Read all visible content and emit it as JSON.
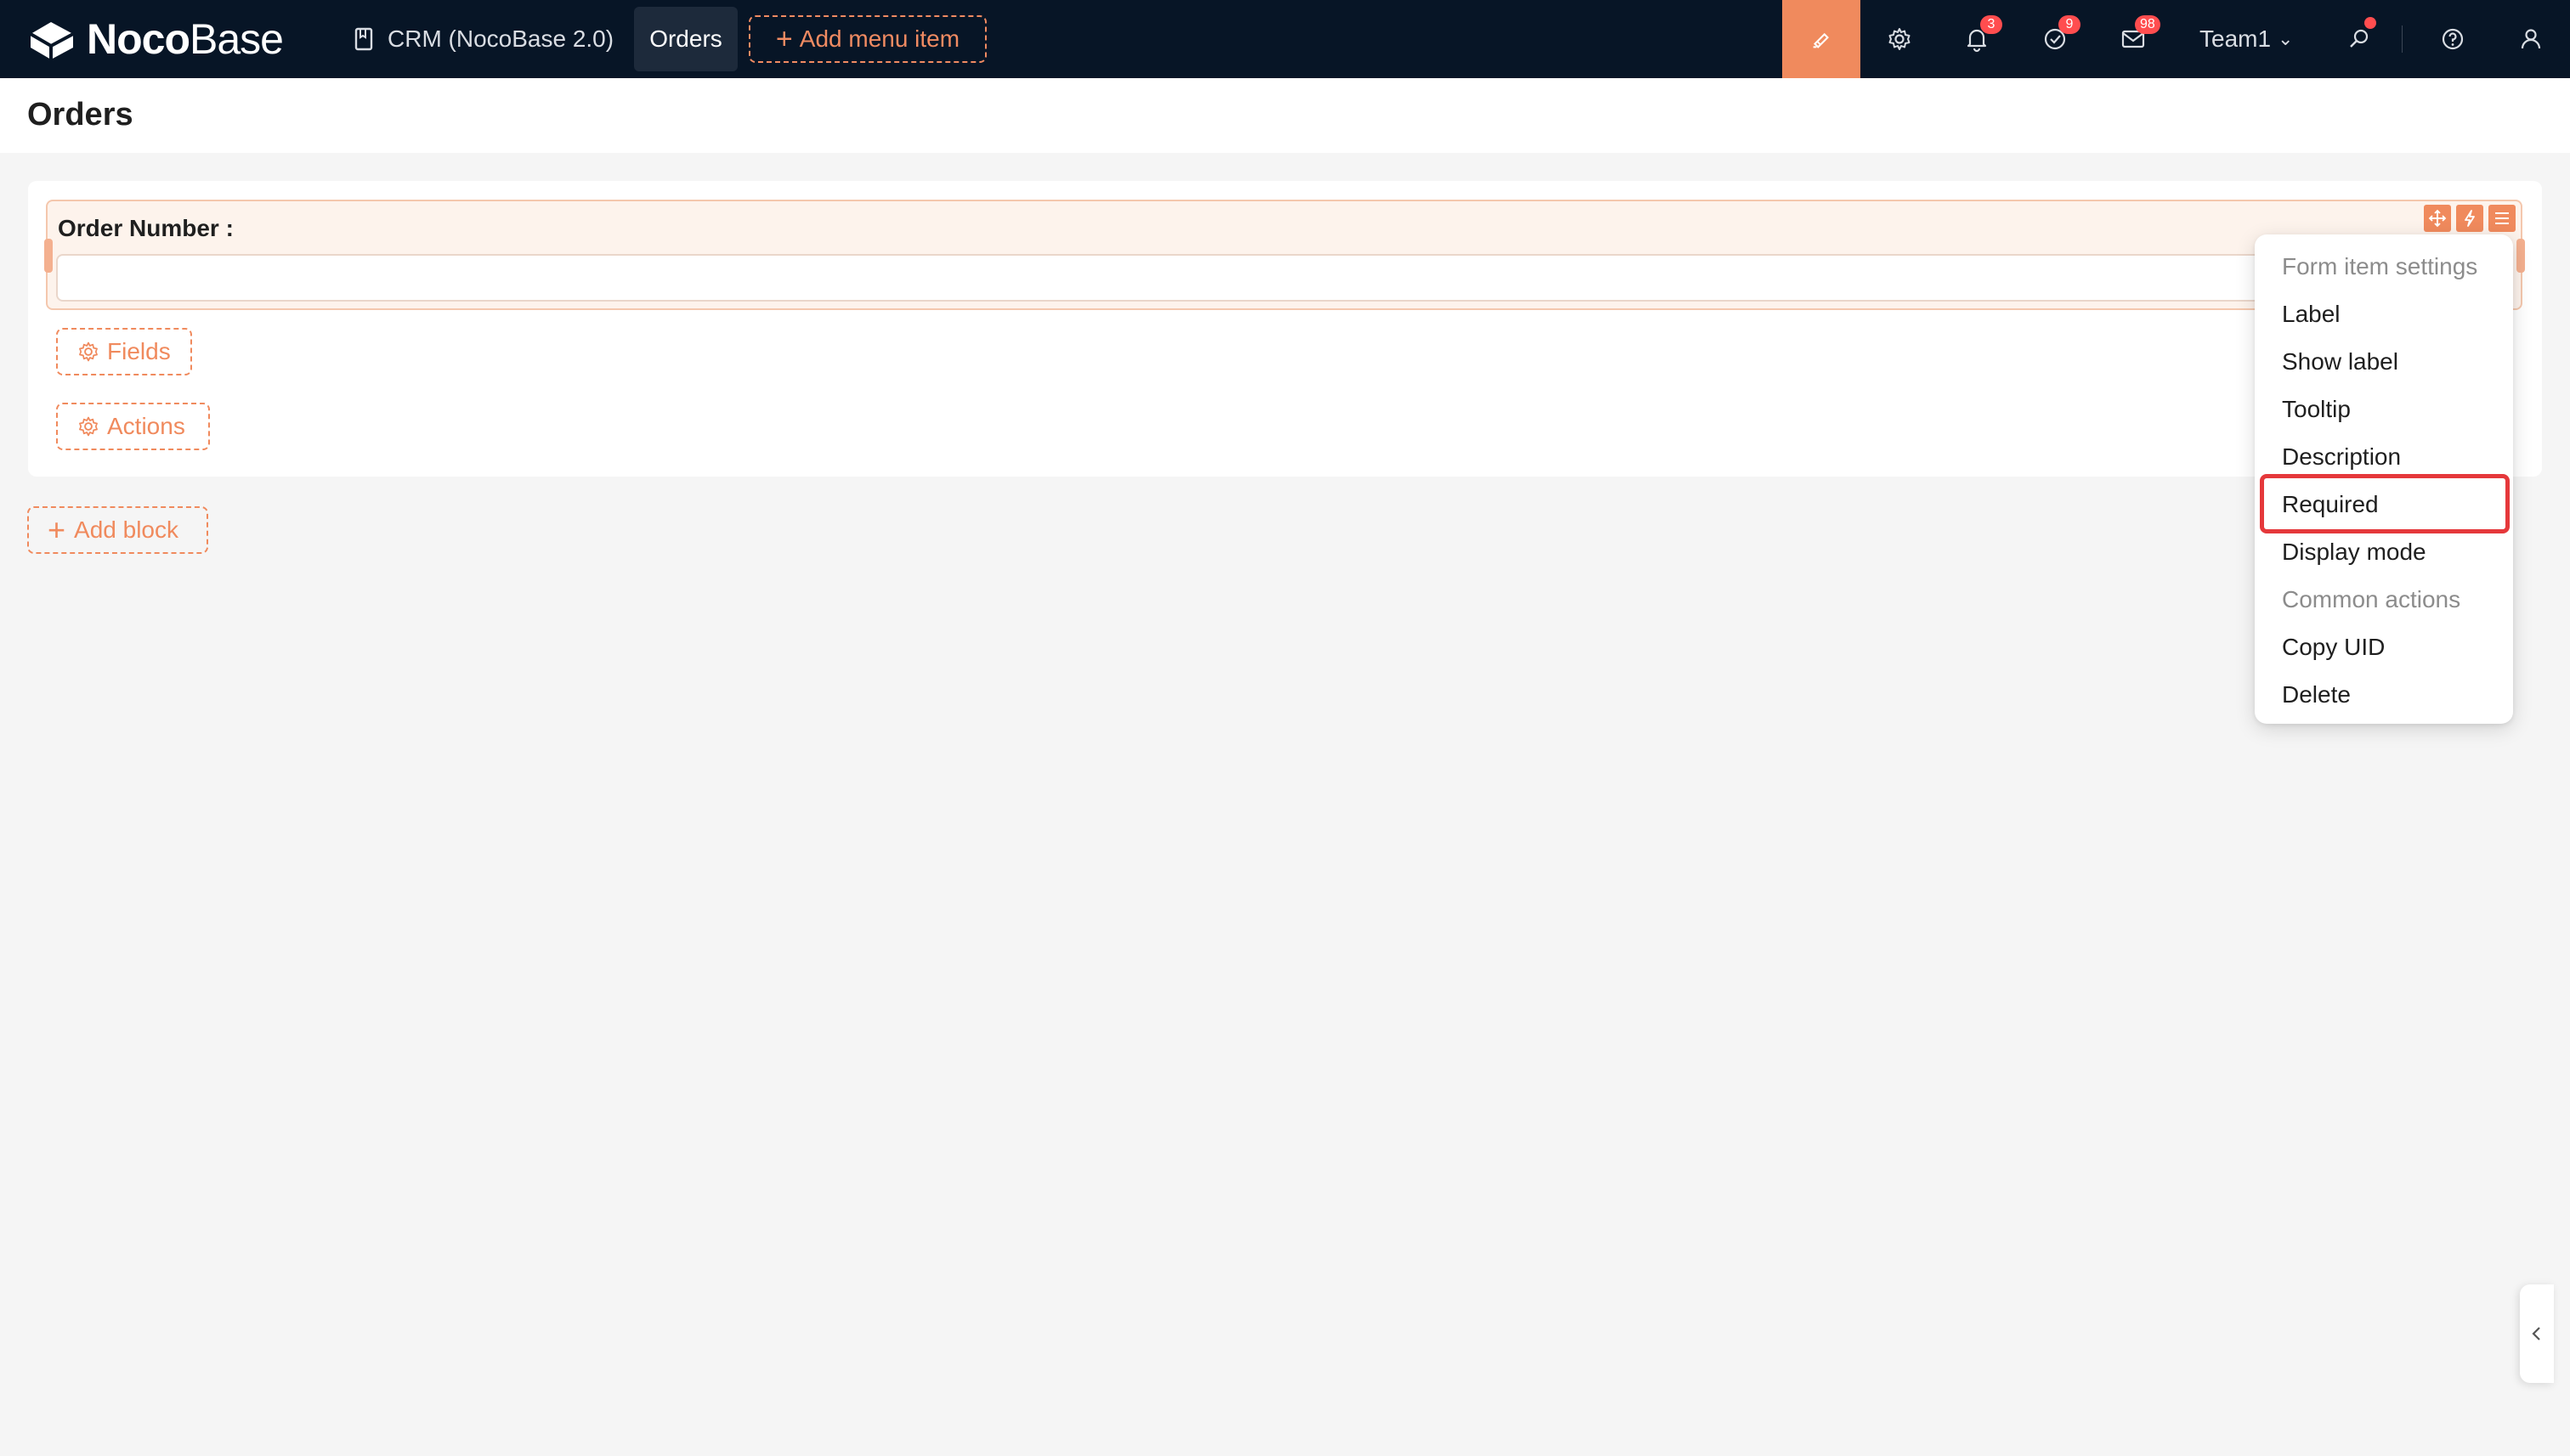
{
  "navbar": {
    "logo_bold": "Noco",
    "logo_light": "Base",
    "app_name": "CRM (NocoBase 2.0)",
    "active_menu": "Orders",
    "add_menu_label": "Add menu item",
    "notification_badge": "3",
    "task_badge": "9",
    "mail_badge": "98",
    "team_label": "Team1",
    "accent_color": "#f08a5d",
    "background_color": "#071526"
  },
  "page": {
    "title": "Orders"
  },
  "form": {
    "field_label": "Order Number :",
    "field_value": "",
    "fields_button": "Fields",
    "actions_button": "Actions"
  },
  "add_block_label": "Add block",
  "settings_menu": {
    "group_form_item": "Form item settings",
    "label": "Label",
    "show_label": "Show label",
    "tooltip": "Tooltip",
    "description": "Description",
    "required": "Required",
    "display_mode": "Display mode",
    "group_common": "Common actions",
    "copy_uid": "Copy UID",
    "delete": "Delete",
    "highlighted_item": "Required",
    "highlight_color": "#e5383b"
  },
  "icons": {
    "logo": "nocobase-logo-icon",
    "app": "document-icon",
    "design": "highlighter-icon",
    "settings": "gear-icon",
    "notifications": "bell-icon",
    "tasks": "check-circle-icon",
    "mail": "mail-icon",
    "search": "search-icon",
    "help": "question-circle-icon",
    "user": "user-icon",
    "collapse": "chevron-left-icon"
  }
}
